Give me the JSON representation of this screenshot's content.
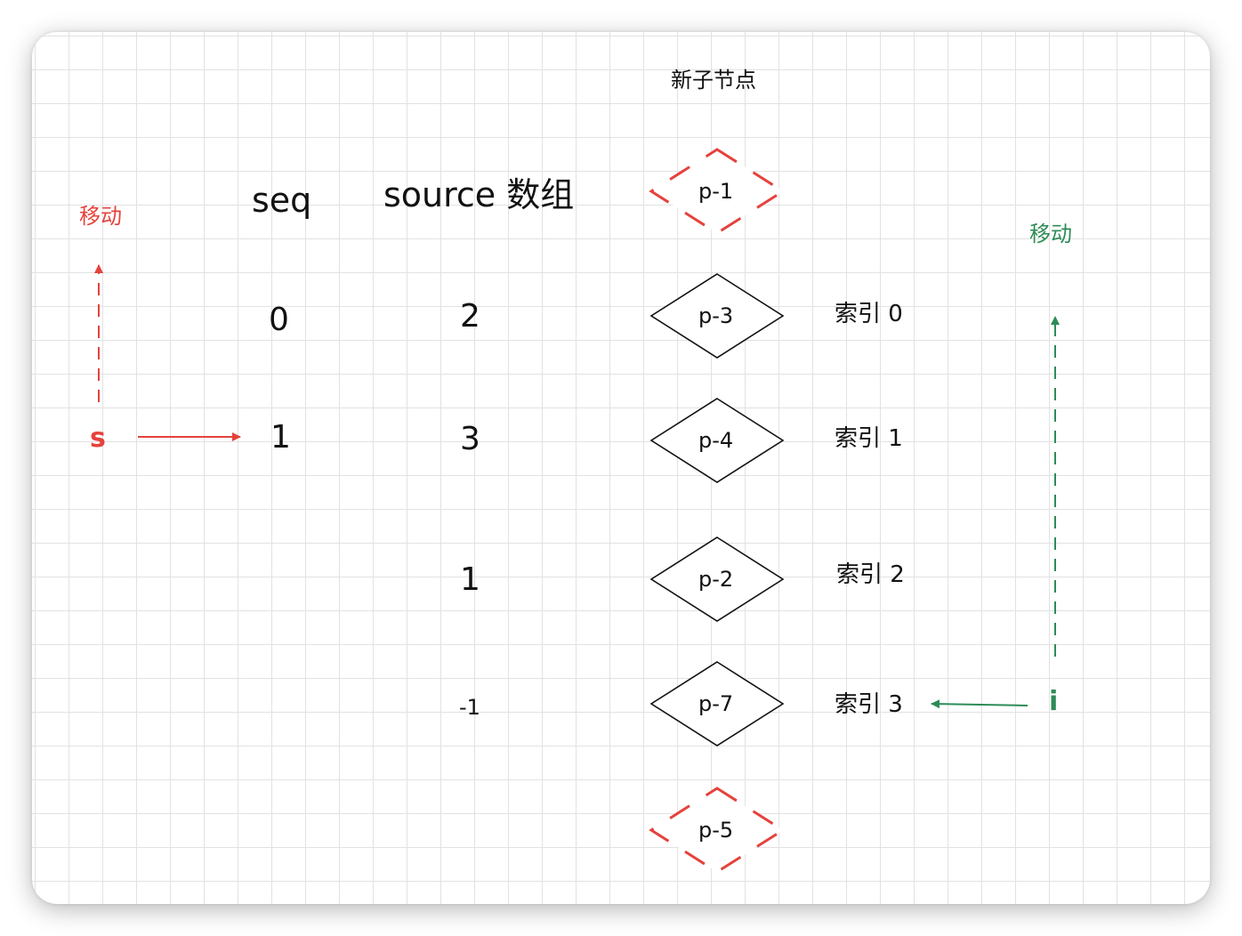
{
  "title": "新子节点",
  "headers": {
    "seq": "seq",
    "source": "source 数组"
  },
  "seq_values": [
    "0",
    "1"
  ],
  "source_values": [
    "2",
    "3",
    "1",
    "-1"
  ],
  "nodes": [
    {
      "label": "p-1",
      "style": "dashed",
      "color": "#e5423c"
    },
    {
      "label": "p-3",
      "style": "solid",
      "color": "#111111"
    },
    {
      "label": "p-4",
      "style": "solid",
      "color": "#111111"
    },
    {
      "label": "p-2",
      "style": "solid",
      "color": "#111111"
    },
    {
      "label": "p-7",
      "style": "solid",
      "color": "#111111"
    },
    {
      "label": "p-5",
      "style": "dashed",
      "color": "#e5423c"
    }
  ],
  "indices": [
    "索引 0",
    "索引 1",
    "索引 2",
    "索引 3"
  ],
  "left_pointer": {
    "label": "s",
    "move_label": "移动",
    "color": "#e5423c"
  },
  "right_pointer": {
    "label": "i",
    "move_label": "移动",
    "color": "#2e8b57"
  }
}
